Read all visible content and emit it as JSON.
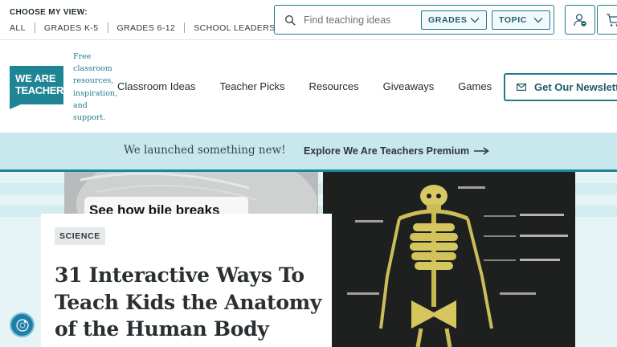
{
  "topbar": {
    "view_label": "CHOOSE MY VIEW:",
    "view_links": [
      "ALL",
      "GRADES K-5",
      "GRADES 6-12",
      "SCHOOL LEADERS"
    ]
  },
  "search": {
    "placeholder": "Find teaching ideas",
    "grades_label": "GRADES",
    "topic_label": "TOPIC"
  },
  "logo": {
    "line1": "WE ARE",
    "line2": "TEACHERS"
  },
  "tagline": "Free classroom resources, inspiration, and support.",
  "nav": [
    "Classroom Ideas",
    "Teacher Picks",
    "Resources",
    "Giveaways",
    "Games"
  ],
  "newsletter_label": "Get Our Newsletter",
  "banner": {
    "text": "We launched something new!",
    "link": "Explore We Are Teachers Premium"
  },
  "hero": {
    "photo_caption": "See how bile breaks",
    "tag": "SCIENCE",
    "headline": "31 Interactive Ways To Teach Kids the Anatomy of the Human Body"
  },
  "colors": {
    "brand_teal": "#1f8594",
    "accent": "#1f7a8c",
    "banner_bg": "#c9e8ed",
    "hero_bg": "#e6f4f6"
  },
  "icons": [
    "search-icon",
    "chevron-down-icon",
    "account-icon",
    "cart-icon",
    "envelope-icon",
    "arrow-right-icon",
    "accessibility-icon"
  ]
}
